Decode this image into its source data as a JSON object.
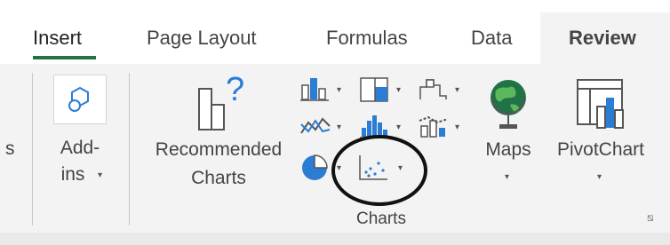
{
  "tabs": [
    {
      "label": "Insert",
      "active": true
    },
    {
      "label": "Page Layout",
      "active": false
    },
    {
      "label": "Formulas",
      "active": false
    },
    {
      "label": "Data",
      "active": false
    },
    {
      "label": "Review",
      "active": false
    }
  ],
  "ribbon": {
    "partial_label": "s",
    "addins": {
      "line1": "Add-",
      "line2": "ins",
      "dropdown": "▾"
    },
    "recommended_charts": {
      "line1": "Recommended",
      "line2": "Charts",
      "icon_glyph": "?"
    },
    "maps": {
      "label": "Maps",
      "dropdown": "▾"
    },
    "pivotchart": {
      "label": "PivotChart",
      "dropdown": "▾"
    },
    "charts_group_label": "Charts",
    "dropdown_glyph": "▾",
    "launcher_glyph": "⧅"
  },
  "colors": {
    "accent_green": "#217346",
    "chart_blue": "#2b7cd3",
    "chart_gray": "#5f5f5f",
    "highlight_circle": "#111111"
  },
  "icons": [
    "addin-store-icon",
    "recommended-charts-icon",
    "column-chart-icon",
    "hierarchy-chart-icon",
    "waterfall-chart-icon",
    "line-chart-icon",
    "statistic-chart-icon",
    "combo-chart-icon",
    "pie-chart-icon",
    "scatter-chart-icon",
    "globe-map-icon",
    "pivotchart-icon",
    "dialog-launcher-icon"
  ]
}
